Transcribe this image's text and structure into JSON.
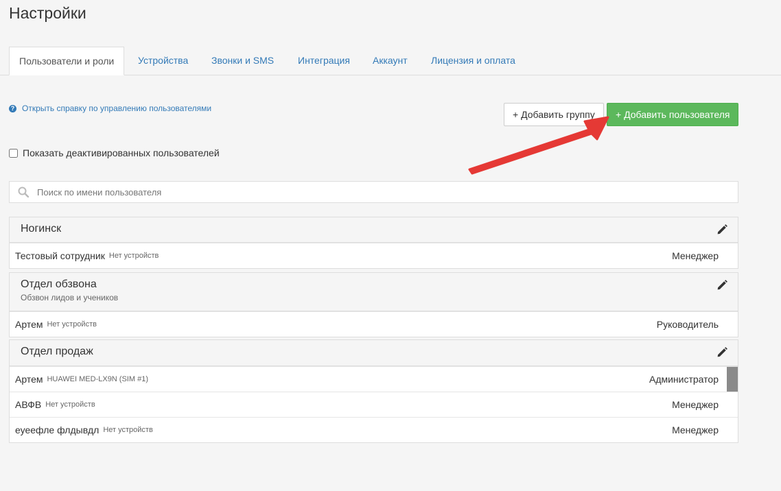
{
  "page": {
    "title": "Настройки"
  },
  "tabs": [
    {
      "label": "Пользователи и роли",
      "active": true
    },
    {
      "label": "Устройства"
    },
    {
      "label": "Звонки и SMS"
    },
    {
      "label": "Интеграция"
    },
    {
      "label": "Аккаунт"
    },
    {
      "label": "Лицензия и оплата"
    }
  ],
  "help": {
    "icon": "question-circle-icon",
    "label": "Открыть справку по управлению пользователями"
  },
  "buttons": {
    "add_group": "+ Добавить группу",
    "add_user": "+ Добавить пользователя"
  },
  "show_deactivated": {
    "label": "Показать деактивированных пользователей",
    "checked": false
  },
  "search": {
    "icon": "search-icon",
    "placeholder": "Поиск по имени пользователя"
  },
  "groups": [
    {
      "name": "Ногинск",
      "description": "",
      "users": [
        {
          "name": "Тестовый сотрудник",
          "device": "Нет устройств",
          "role": "Менеджер"
        }
      ]
    },
    {
      "name": "Отдел обзвона",
      "description": "Обзвон лидов и учеников",
      "users": [
        {
          "name": "Артем",
          "device": "Нет устройств",
          "role": "Руководитель"
        }
      ]
    },
    {
      "name": "Отдел продаж",
      "description": "",
      "users": [
        {
          "name": "Артем",
          "device": "HUAWEI MED-LX9N (SIM #1)",
          "role": "Администратор"
        },
        {
          "name": "АВФВ",
          "device": "Нет устройств",
          "role": "Менеджер"
        },
        {
          "name": "еуеефле флдывдл",
          "device": "Нет устройств",
          "role": "Менеджер"
        }
      ]
    }
  ],
  "colors": {
    "primary": "#337ab7",
    "success": "#5cb85c",
    "annotation_arrow": "#e53935"
  }
}
